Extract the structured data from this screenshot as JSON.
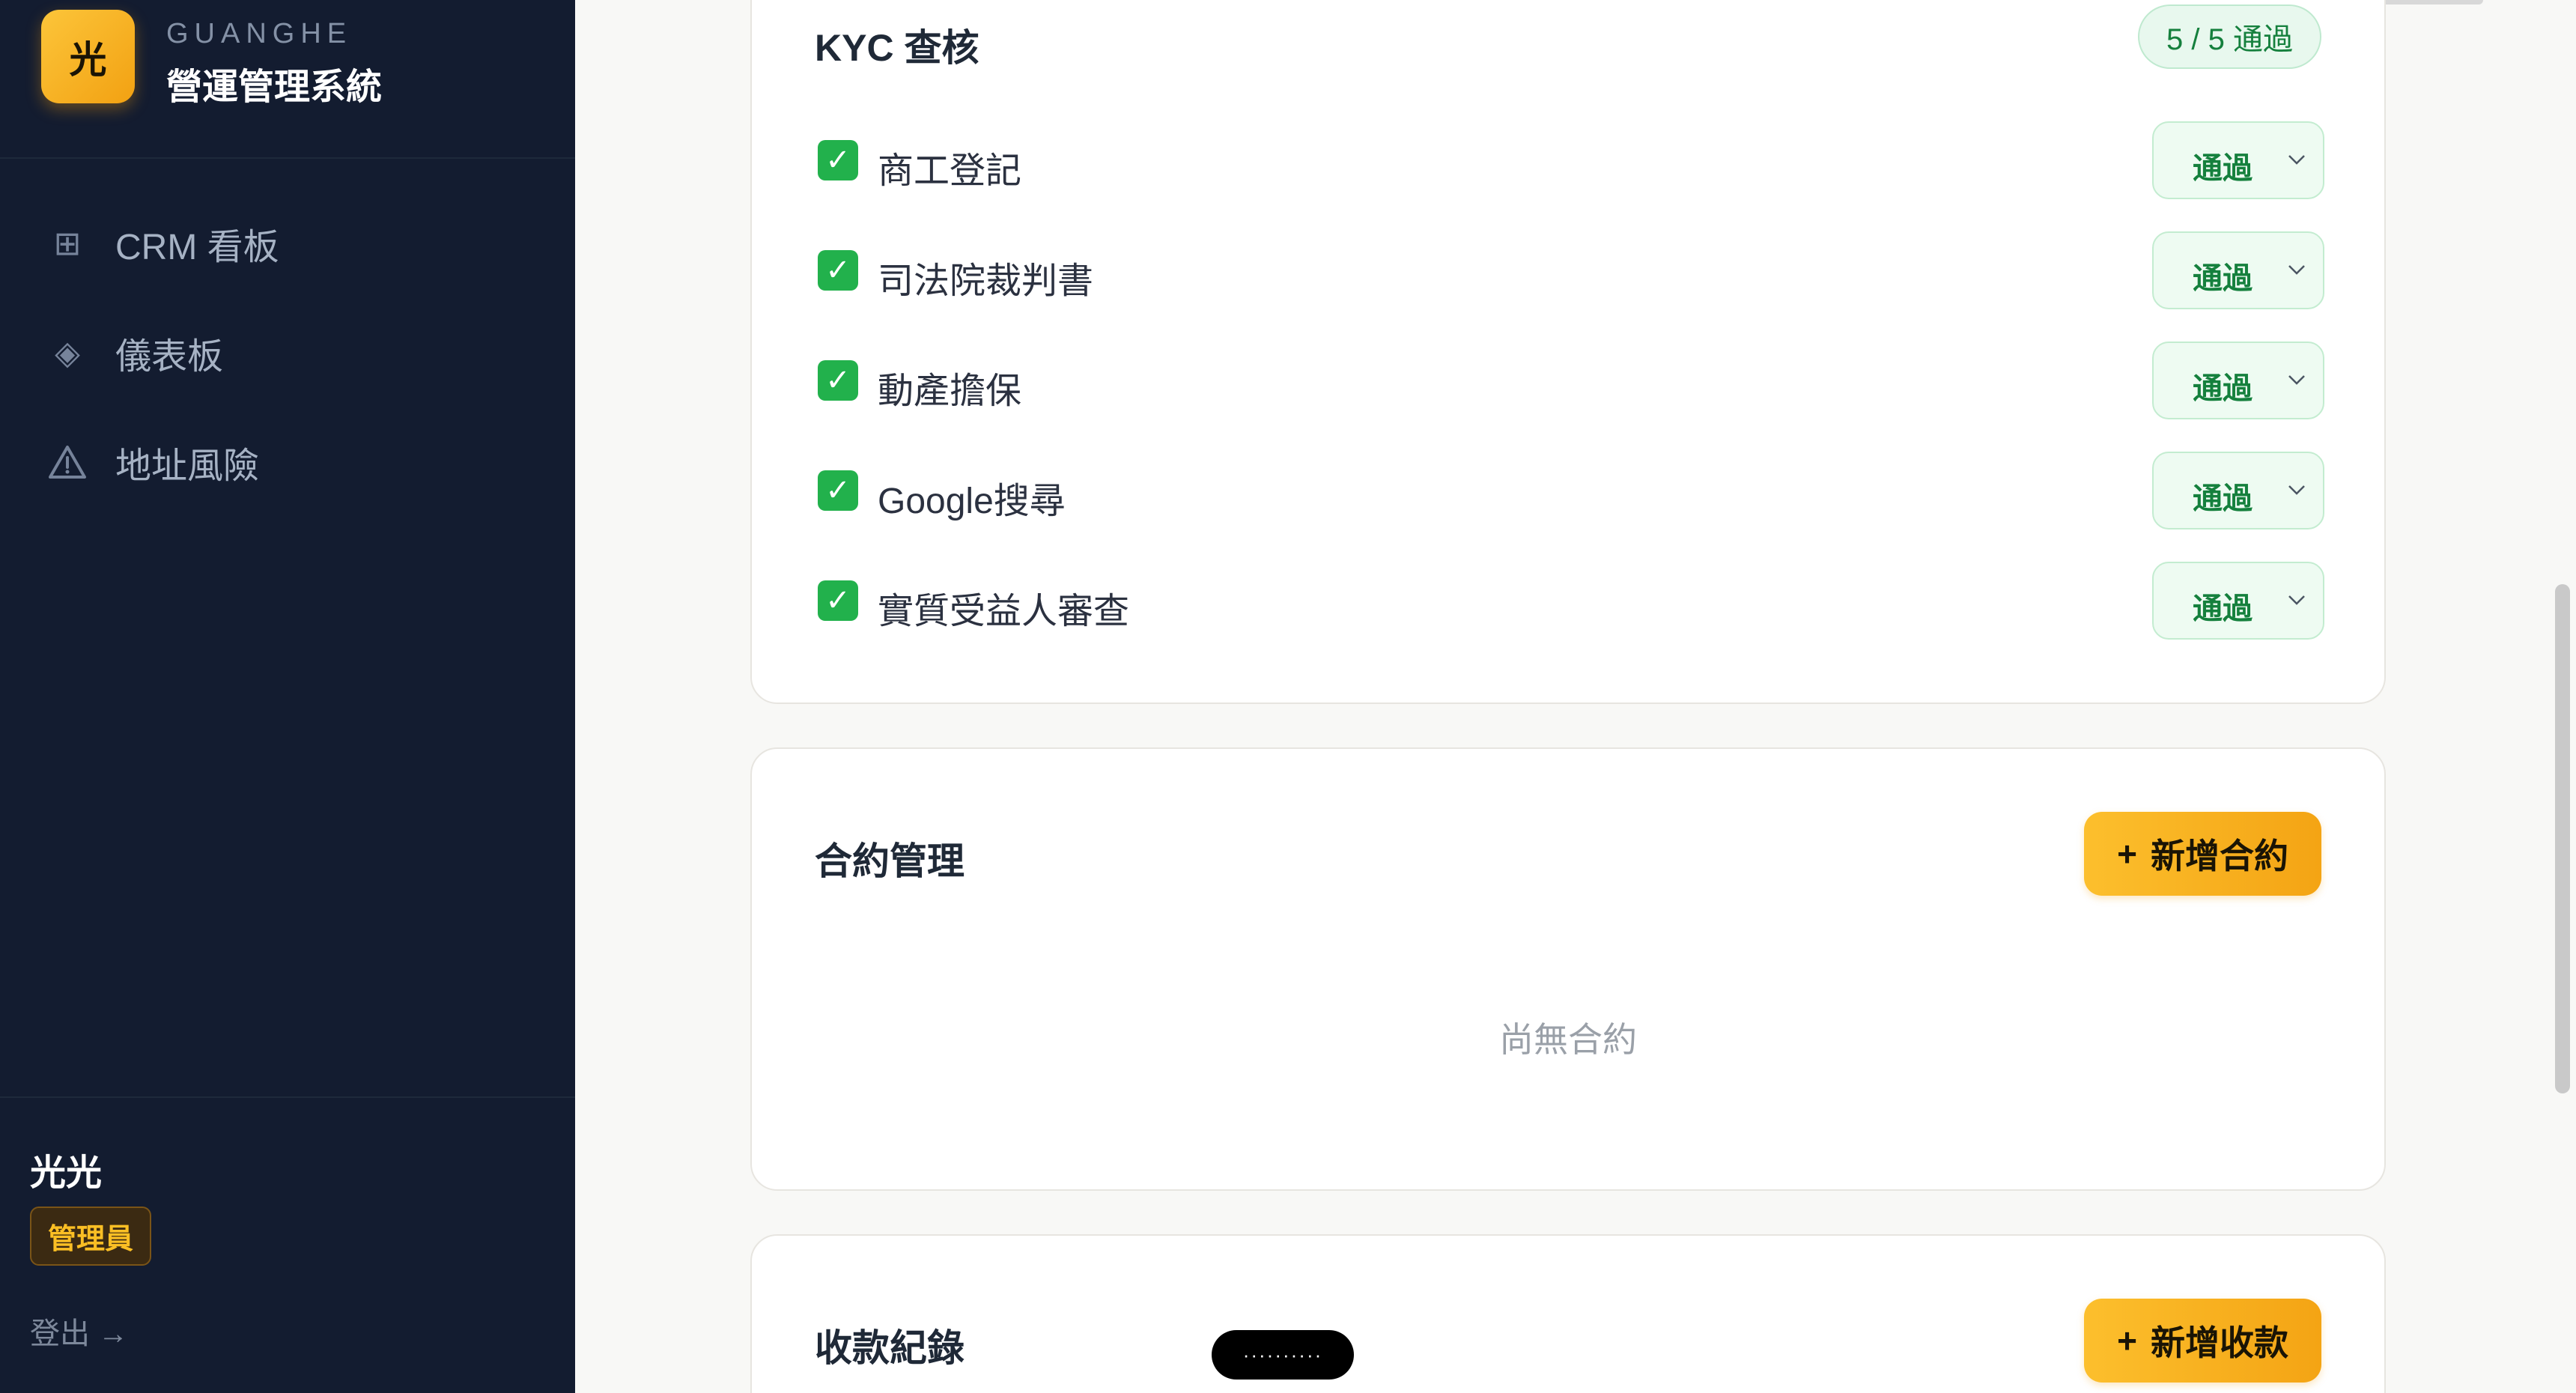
{
  "brand": {
    "logo_char": "光",
    "subtitle": "GUANGHE",
    "title": "營運管理系統"
  },
  "nav": {
    "items": [
      {
        "label": "CRM 看板",
        "icon": "grid-icon"
      },
      {
        "label": "儀表板",
        "icon": "diamond-icon"
      },
      {
        "label": "地址風險",
        "icon": "warning-triangle-icon"
      }
    ]
  },
  "user": {
    "name": "光光",
    "role": "管理員",
    "logout": "登出 →"
  },
  "kyc": {
    "title": "KYC 查核",
    "summary": "5 / 5 通過",
    "items": [
      {
        "label": "商工登記",
        "status": "通過"
      },
      {
        "label": "司法院裁判書",
        "status": "通過"
      },
      {
        "label": "動產擔保",
        "status": "通過"
      },
      {
        "label": "Google搜尋",
        "status": "通過"
      },
      {
        "label": "實質受益人審查",
        "status": "通過"
      }
    ]
  },
  "contracts": {
    "title": "合約管理",
    "add_label": "新增合約",
    "empty": "尚無合約"
  },
  "payments": {
    "title": "收款紀錄",
    "add_label": "新增收款"
  },
  "pill": {
    "text": "··········"
  },
  "colors": {
    "sidebar_bg": "#131c30",
    "accent": "#f4a414",
    "pass_green": "#15803d"
  }
}
